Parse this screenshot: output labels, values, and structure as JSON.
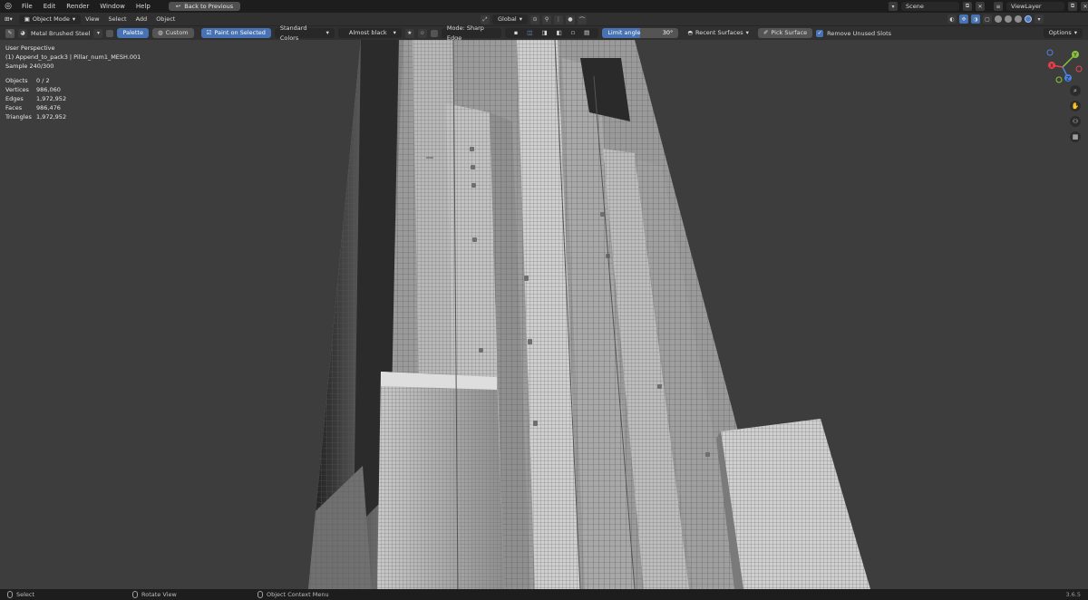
{
  "topbar": {
    "menus": [
      "File",
      "Edit",
      "Render",
      "Window",
      "Help"
    ],
    "back_label": "Back to Previous",
    "scene": "Scene",
    "view_layer": "ViewLayer"
  },
  "header": {
    "mode": "Object Mode",
    "menus": [
      "View",
      "Select",
      "Add",
      "Object"
    ],
    "orientation": "Global"
  },
  "toolbar": {
    "material": "Metal Brushed Steel",
    "palette_label": "Palette",
    "custom_label": "Custom",
    "paint_selected_label": "Paint on Selected",
    "color_set": "Standard Colors",
    "color_name": "Almost black",
    "mode_label": "Mode: Sharp Edge",
    "limit_label": "Limit angle",
    "limit_value": "30°",
    "limit_fraction": 0.5,
    "recent_label": "Recent Surfaces",
    "pick_label": "Pick Surface",
    "remove_unused_label": "Remove Unused Slots",
    "remove_unused_checked": true,
    "options_label": "Options"
  },
  "viewport": {
    "perspective": "User Perspective",
    "object_name": "(1) Append_to_pack3 | Pillar_num1_MESH.001",
    "sample": "Sample 240/300",
    "stats": [
      {
        "label": "Objects",
        "value": "0 / 2"
      },
      {
        "label": "Vertices",
        "value": "986,060"
      },
      {
        "label": "Edges",
        "value": "1,972,952"
      },
      {
        "label": "Faces",
        "value": "986,476"
      },
      {
        "label": "Triangles",
        "value": "1,972,952"
      }
    ]
  },
  "gizmo": {
    "x": "X",
    "y": "Y",
    "z": "Z",
    "x_color": "#e8434b",
    "y_color": "#8bc43f",
    "z_color": "#4b82e0"
  },
  "statusbar": {
    "select": "Select",
    "rotate": "Rotate View",
    "context": "Object Context Menu",
    "version": "3.6.5"
  },
  "colors": {
    "accent": "#4772b3",
    "viewport_bg": "#3d3d3d"
  }
}
